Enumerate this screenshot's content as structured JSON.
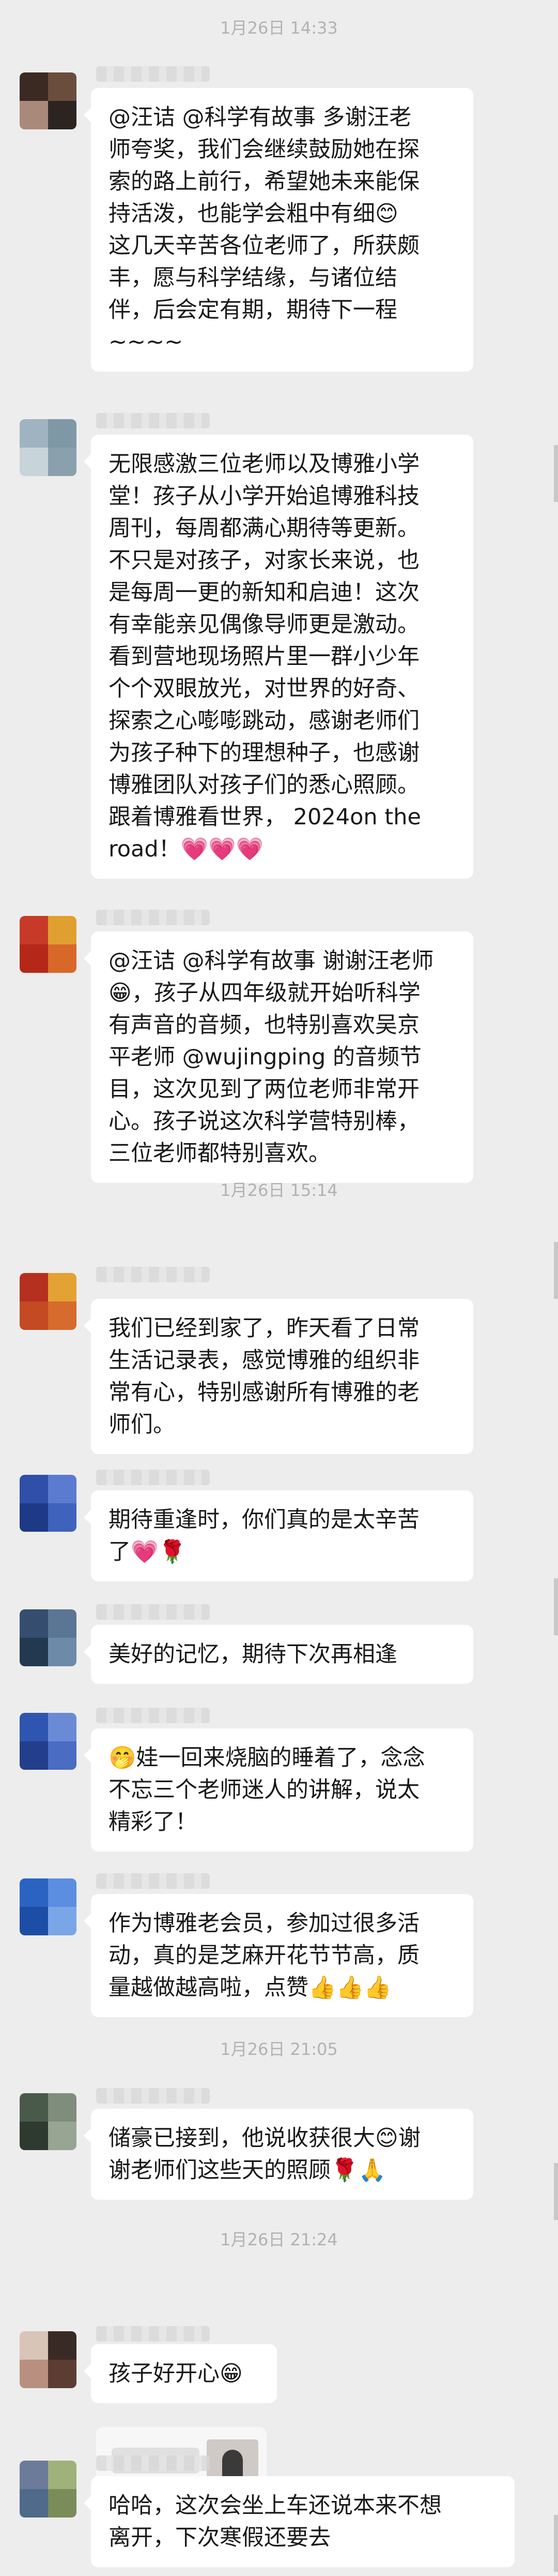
{
  "colors": {
    "background": "#ededed",
    "bubble": "#ffffff",
    "text": "#191919",
    "timestamp": "#b2b2b2"
  },
  "timestamps": [
    {
      "text": "1月26日 14:33"
    },
    {
      "text": "1月26日 15:14"
    },
    {
      "text": "1月26日 21:05"
    },
    {
      "text": "1月26日 21:24"
    }
  ],
  "messages": [
    {
      "text": "@汪诘 @科学有故事  多谢汪老\n师夸奖，我们会继续鼓励她在探\n索的路上前行，希望她未来能保\n持活泼，也能学会粗中有细😊\n这几天辛苦各位老师了，所获颇\n丰，愿与科学结缘，与诸位结\n伴，后会定有期，期待下一程\n~~~~"
    },
    {
      "text": "无限感激三位老师以及博雅小学\n堂！孩子从小学开始追博雅科技\n周刊，每周都满心期待等更新。\n不只是对孩子，对家长来说，也\n是每周一更的新知和启迪！这次\n有幸能亲见偶像导师更是激动。\n看到营地现场照片里一群小少年\n个个双眼放光，对世界的好奇、\n探索之心嘭嘭跳动，感谢老师们\n为孩子种下的理想种子，也感谢\n博雅团队对孩子们的悉心照顾。\n跟着博雅看世界， 2024on the\nroad！💗💗💗"
    },
    {
      "text": "@汪诘 @科学有故事 谢谢汪老师\n😁，孩子从四年级就开始听科学\n有声音的音频，也特别喜欢吴京\n平老师 @wujingping 的音频节\n目，这次见到了两位老师非常开\n心。孩子说这次科学营特别棒，\n三位老师都特别喜欢。"
    },
    {
      "text": "我们已经到家了，昨天看了日常\n生活记录表，感觉博雅的组织非\n常有心，特别感谢所有博雅的老\n师们。"
    },
    {
      "text": "期待重逢时，你们真的是太辛苦\n了💗🌹"
    },
    {
      "text": "美好的记忆，期待下次再相逢"
    },
    {
      "text": "🤭娃一回来烧脑的睡着了，念念\n不忘三个老师迷人的讲解，说太\n精彩了！"
    },
    {
      "text": "作为博雅老会员，参加过很多活\n动，真的是芝麻开花节节高，质\n量越做越高啦，点赞👍👍👍"
    },
    {
      "text": "储豪已接到，他说收获很大😊谢\n谢老师们这些天的照顾🌹🙏"
    },
    {
      "text": "孩子好开心😁"
    },
    {
      "text": "哈哈，这次会坐上车还说本来不想\n离开，下次寒假还要去"
    }
  ]
}
